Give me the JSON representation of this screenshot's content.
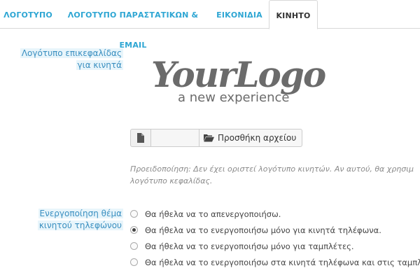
{
  "tabs": [
    {
      "label": "ΛΟΓΟΤΥΠΟ",
      "active": false
    },
    {
      "label": "ΛΟΓΟΤΥΠΟ ΠΑΡΑΣΤΑΤΙΚΩΝ & EMAIL",
      "active": false
    },
    {
      "label": "ΕΙΚΟΝΙΔΙΑ",
      "active": false
    },
    {
      "label": "ΚΙΝΗΤΟ",
      "active": true
    }
  ],
  "header_logo": {
    "label_line1": "Λογότυπο επικεφαλίδας",
    "label_line2": "για κινητά",
    "logo_main": "YourLogo",
    "logo_tagline": "a new experience"
  },
  "file_upload": {
    "button_label": "Προσθήκη αρχείου"
  },
  "warning": {
    "line1": "Προειδοποίηση: Δεν έχει οριστεί λογότυπο κινητών. Αν αυτού, θα χρησιμ",
    "line2": "λογότυπο κεφαλίδας."
  },
  "mobile_theme": {
    "label_line1": "Ενεργοποίηση θέμα",
    "label_line2": "κινητού τηλεφώνου",
    "options": [
      {
        "label": "Θα ήθελα να το απενεργοποιήσω.",
        "checked": false
      },
      {
        "label": "Θα ήθελα να το ενεργοποιήσω μόνο για κινητά τηλέφωνα.",
        "checked": true
      },
      {
        "label": "Θα ήθελα να το ενεργοποιήσω μόνο για ταμπλέτες.",
        "checked": false
      },
      {
        "label": "Θα ήθελα να το ενεργοποιήσω στα κινητά τηλέφωνα και στις ταμπλέτ",
        "checked": false
      }
    ]
  },
  "colors": {
    "accent": "#2ea6d3",
    "label": "#3a8fc0",
    "logo": "#6b6b6b"
  }
}
